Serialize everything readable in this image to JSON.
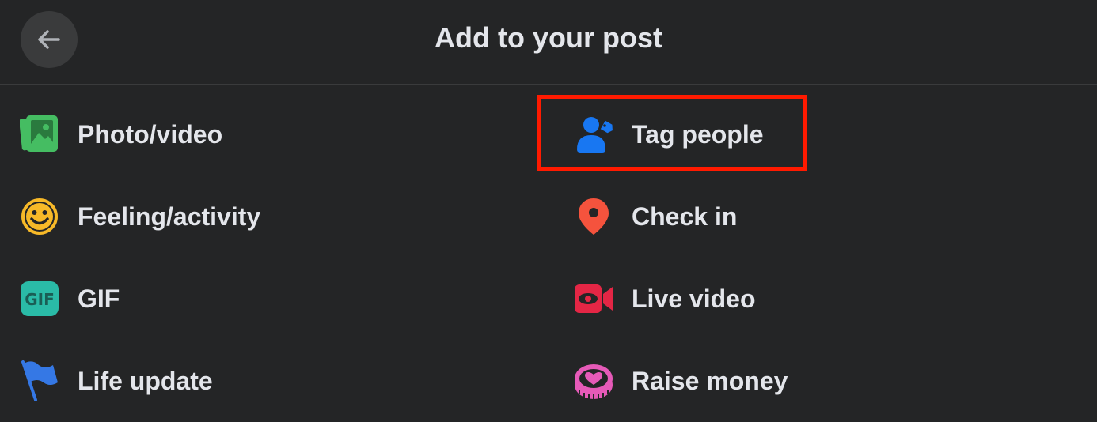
{
  "header": {
    "title": "Add to your post",
    "back_icon": "arrow-left-icon"
  },
  "options": [
    {
      "label": "Photo/video",
      "icon": "photo-video-icon",
      "color": "#45bd62"
    },
    {
      "label": "Tag people",
      "icon": "tag-people-icon",
      "color": "#1877f2"
    },
    {
      "label": "Feeling/activity",
      "icon": "smiley-icon",
      "color": "#f7b928"
    },
    {
      "label": "Check in",
      "icon": "location-pin-icon",
      "color": "#f5533d"
    },
    {
      "label": "GIF",
      "icon": "gif-icon",
      "color": "#2abba7"
    },
    {
      "label": "Live video",
      "icon": "live-video-icon",
      "color": "#e42645"
    },
    {
      "label": "Life update",
      "icon": "flag-icon",
      "color": "#3578e5"
    },
    {
      "label": "Raise money",
      "icon": "heart-coin-icon",
      "color": "#e65ab8"
    }
  ],
  "highlight_color": "#ff1a00"
}
